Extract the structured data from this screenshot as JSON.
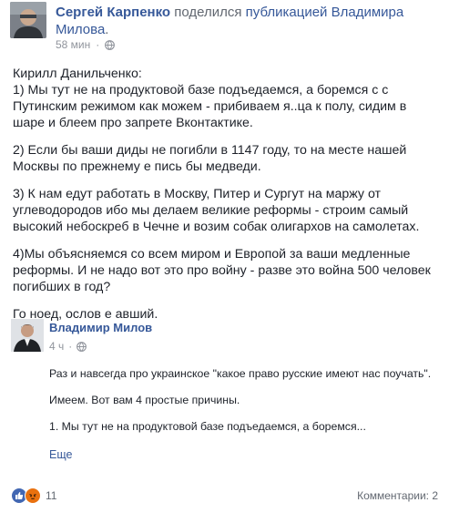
{
  "header": {
    "author": "Сергей Карпенко",
    "action": " поделился ",
    "link": "публикацией Владимира Милова",
    "suffix": ".",
    "time": "58 мин",
    "dot": "·"
  },
  "post": {
    "paragraphs": [
      "Кирилл Данильченко:\n1) Мы тут не на продуктовой базе подъедаемся, а боремся с с Путинским режимом как можем - прибиваем я..ца к полу, сидим в шаре и блеем про запрете Вконтактике.",
      "2) Если бы ваши диды не погибли в 1147 году, то на месте нашей Москвы по прежнему е  пись бы медведи.",
      "3) К нам едут работать в Москву, Питер и Сургут на маржу от углеводородов ибо мы делаем великие реформы - строим самый высокий небоскреб в Чечне и возим собак олигархов на самолетах.",
      "4)Мы объясняемся со всем миром и Европой за ваши медленные реформы. И не надо вот это про войну - разве это война 500 человек погибших в год?",
      "Го  ноед, ослов е  авший."
    ]
  },
  "shared": {
    "author": "Владимир Милов",
    "time": "4 ч",
    "dot": "·",
    "paragraphs": [
      "Раз и навсегда про украинское \"какое право русские имеют нас поучать\".",
      "Имеем. Вот вам 4 простые причины.",
      "1. Мы тут не на продуктовой базе подъедаемся, а боремся..."
    ],
    "more_label": "Еще"
  },
  "footer": {
    "reaction_count": "11",
    "comments_label": "Комментарии: 2"
  },
  "colors": {
    "link": "#365899",
    "meta": "#90949c",
    "like": "#4267b2",
    "angry": "#e9710f"
  },
  "icons": {
    "globe": "globe-icon",
    "like": "like-icon",
    "angry": "angry-icon"
  }
}
